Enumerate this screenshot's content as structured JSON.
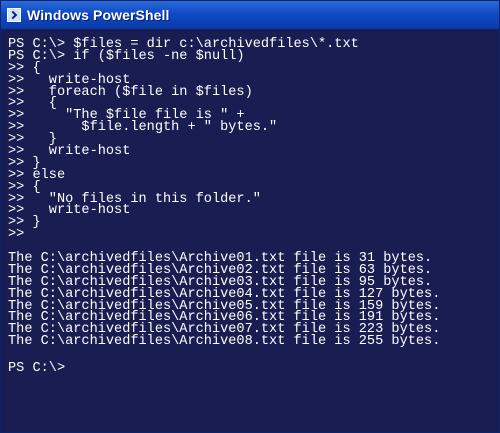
{
  "window": {
    "title": "Windows PowerShell",
    "icon": "powershell-icon"
  },
  "console": {
    "command_lines": [
      "PS C:\\> $files = dir c:\\archivedfiles\\*.txt",
      "PS C:\\> if ($files -ne $null)",
      ">> {",
      ">>   write-host",
      ">>   foreach ($file in $files)",
      ">>   {",
      ">>     \"The $file file is \" +",
      ">>       $file.length + \" bytes.\"",
      ">>   }",
      ">>   write-host",
      ">> }",
      ">> else",
      ">> {",
      ">>   \"No files in this folder.\"",
      ">>   write-host",
      ">> }",
      ">>"
    ],
    "output_lines": [
      "The C:\\archivedfiles\\Archive01.txt file is 31 bytes.",
      "The C:\\archivedfiles\\Archive02.txt file is 63 bytes.",
      "The C:\\archivedfiles\\Archive03.txt file is 95 bytes.",
      "The C:\\archivedfiles\\Archive04.txt file is 127 bytes.",
      "The C:\\archivedfiles\\Archive05.txt file is 159 bytes.",
      "The C:\\archivedfiles\\Archive06.txt file is 191 bytes.",
      "The C:\\archivedfiles\\Archive07.txt file is 223 bytes.",
      "The C:\\archivedfiles\\Archive08.txt file is 255 bytes."
    ],
    "prompt": "PS C:\\>"
  },
  "colors": {
    "console_background": "#1a1d52",
    "console_text": "#ffffff",
    "titlebar": "#0f4bc6"
  }
}
